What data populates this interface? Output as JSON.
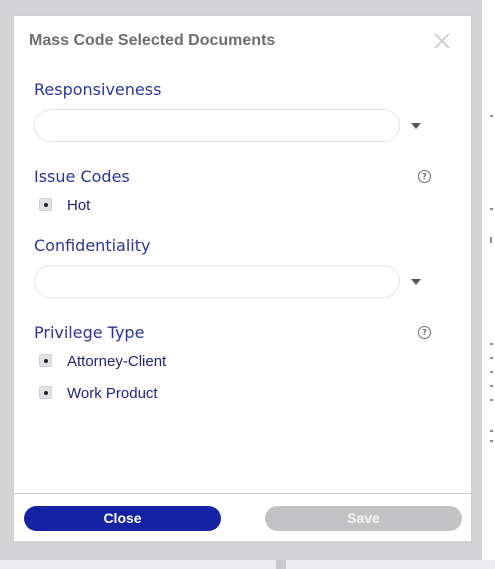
{
  "modal": {
    "title": "Mass Code Selected Documents",
    "close_icon": "close-icon"
  },
  "fields": {
    "responsiveness": {
      "label": "Responsiveness",
      "value": ""
    },
    "issue_codes": {
      "label": "Issue Codes",
      "help_icon": "help-circle-icon",
      "options": [
        {
          "label": "Hot",
          "checked": false
        }
      ]
    },
    "confidentiality": {
      "label": "Confidentiality",
      "value": ""
    },
    "privilege_type": {
      "label": "Privilege Type",
      "help_icon": "help-circle-icon",
      "options": [
        {
          "label": "Attorney-Client",
          "checked": false
        },
        {
          "label": "Work Product",
          "checked": false
        }
      ]
    }
  },
  "footer": {
    "close_label": "Close",
    "save_label": "Save"
  },
  "colors": {
    "primary": "#1622a4",
    "label": "#2a3696",
    "disabled": "#c2c2c4"
  }
}
